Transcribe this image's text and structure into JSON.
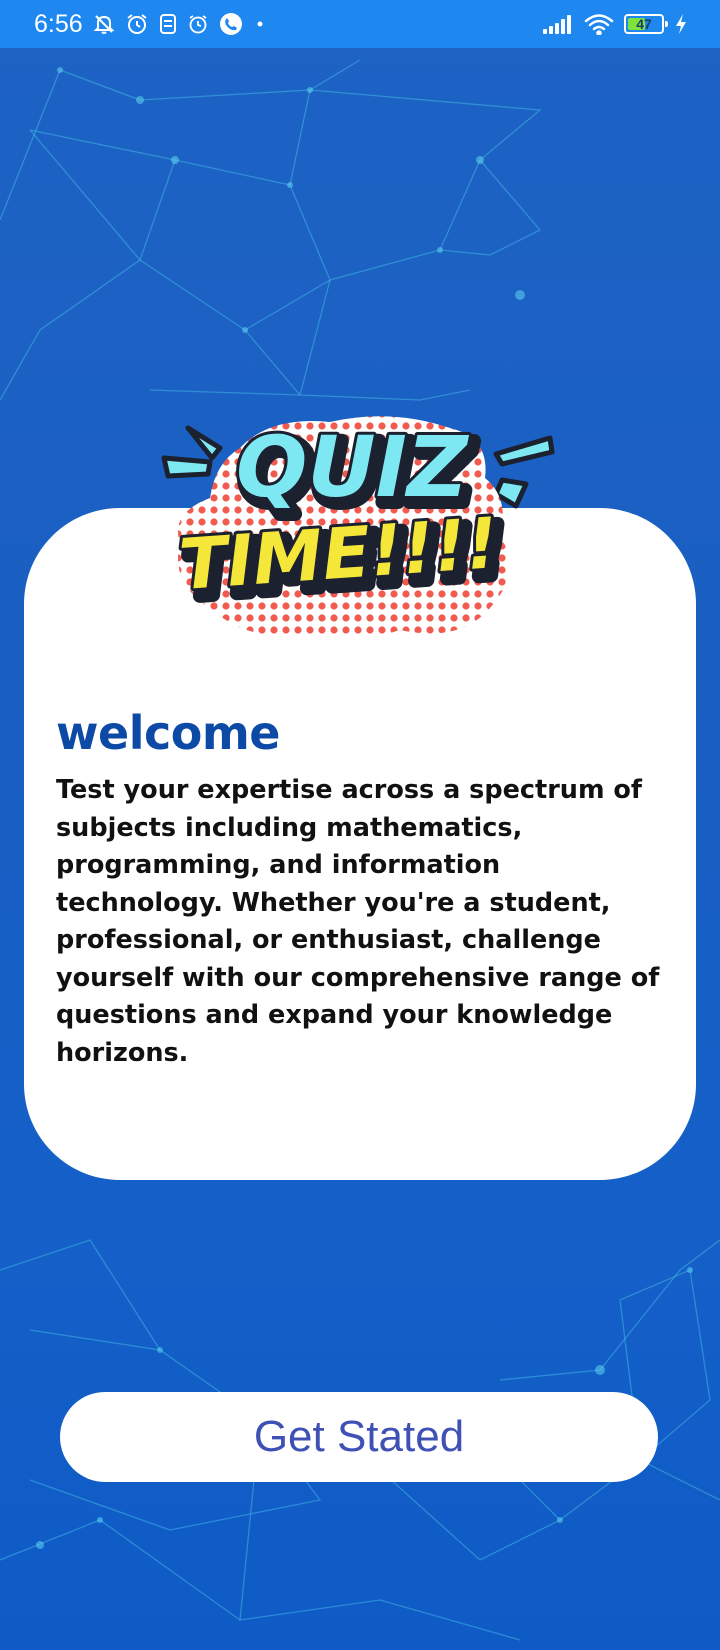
{
  "status_bar": {
    "time": "6:56",
    "battery_level": "47",
    "icons": [
      "mute-bell-icon",
      "alarm-icon",
      "sim-icon",
      "alarm-clock-icon",
      "phone-icon",
      "dot-icon",
      "signal-icon",
      "wifi-icon",
      "battery-icon",
      "charging-icon"
    ]
  },
  "logo": {
    "line1": "QUIZ",
    "line2": "TIME!!!!"
  },
  "welcome": {
    "title": "welcome",
    "body": "Test your expertise across a spectrum of subjects including mathematics, programming, and information technology. Whether you're a student, professional, or enthusiast, challenge yourself with our comprehensive range of questions and expand your knowledge horizons."
  },
  "cta": {
    "label": "Get Stated"
  },
  "colors": {
    "background": "#1a5fc2",
    "status_bar": "#1e88f0",
    "title": "#0d4aa6",
    "button_text": "#3f51b5",
    "logo_cyan": "#7ee8f2",
    "logo_yellow": "#f5e63a",
    "logo_dots": "#f05a4f"
  }
}
